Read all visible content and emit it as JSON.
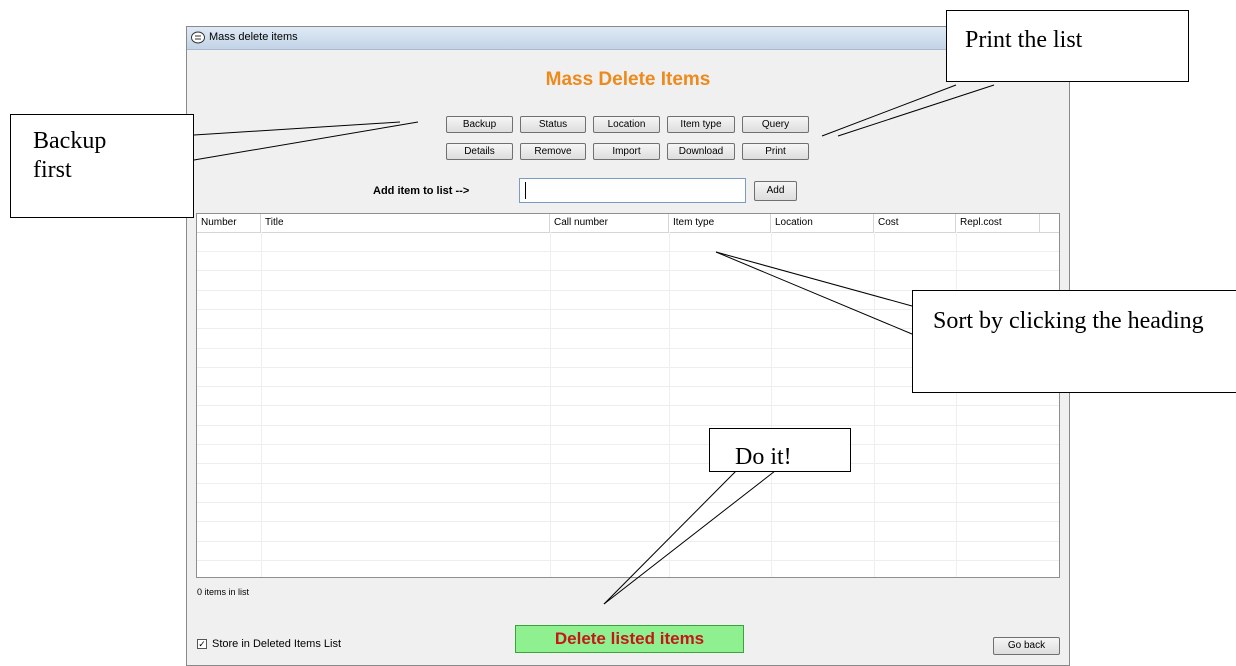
{
  "window": {
    "title": "Mass delete items",
    "heading": "Mass Delete Items"
  },
  "toolbar": {
    "row1": [
      "Backup",
      "Status",
      "Location",
      "Item type",
      "Query"
    ],
    "row2": [
      "Details",
      "Remove",
      "Import",
      "Download",
      "Print"
    ]
  },
  "add_item": {
    "label": "Add item to list -->",
    "value": "",
    "button": "Add"
  },
  "grid": {
    "columns": [
      "Number",
      "Title",
      "Call number",
      "Item type",
      "Location",
      "Cost",
      "Repl.cost"
    ],
    "rows": []
  },
  "status": {
    "count_text": "0 items in list"
  },
  "footer": {
    "store_label": "Store in Deleted Items List",
    "store_checked": true,
    "delete_label": "Delete listed items",
    "go_back_label": "Go back"
  },
  "annotations": {
    "print": "Print the list",
    "backup": "Backup first",
    "sort": "Sort by clicking the heading",
    "do_it": "Do it!"
  },
  "colors": {
    "heading": "#ee8a1c",
    "delete_bg": "#8ff08f",
    "delete_text": "#c41818"
  }
}
